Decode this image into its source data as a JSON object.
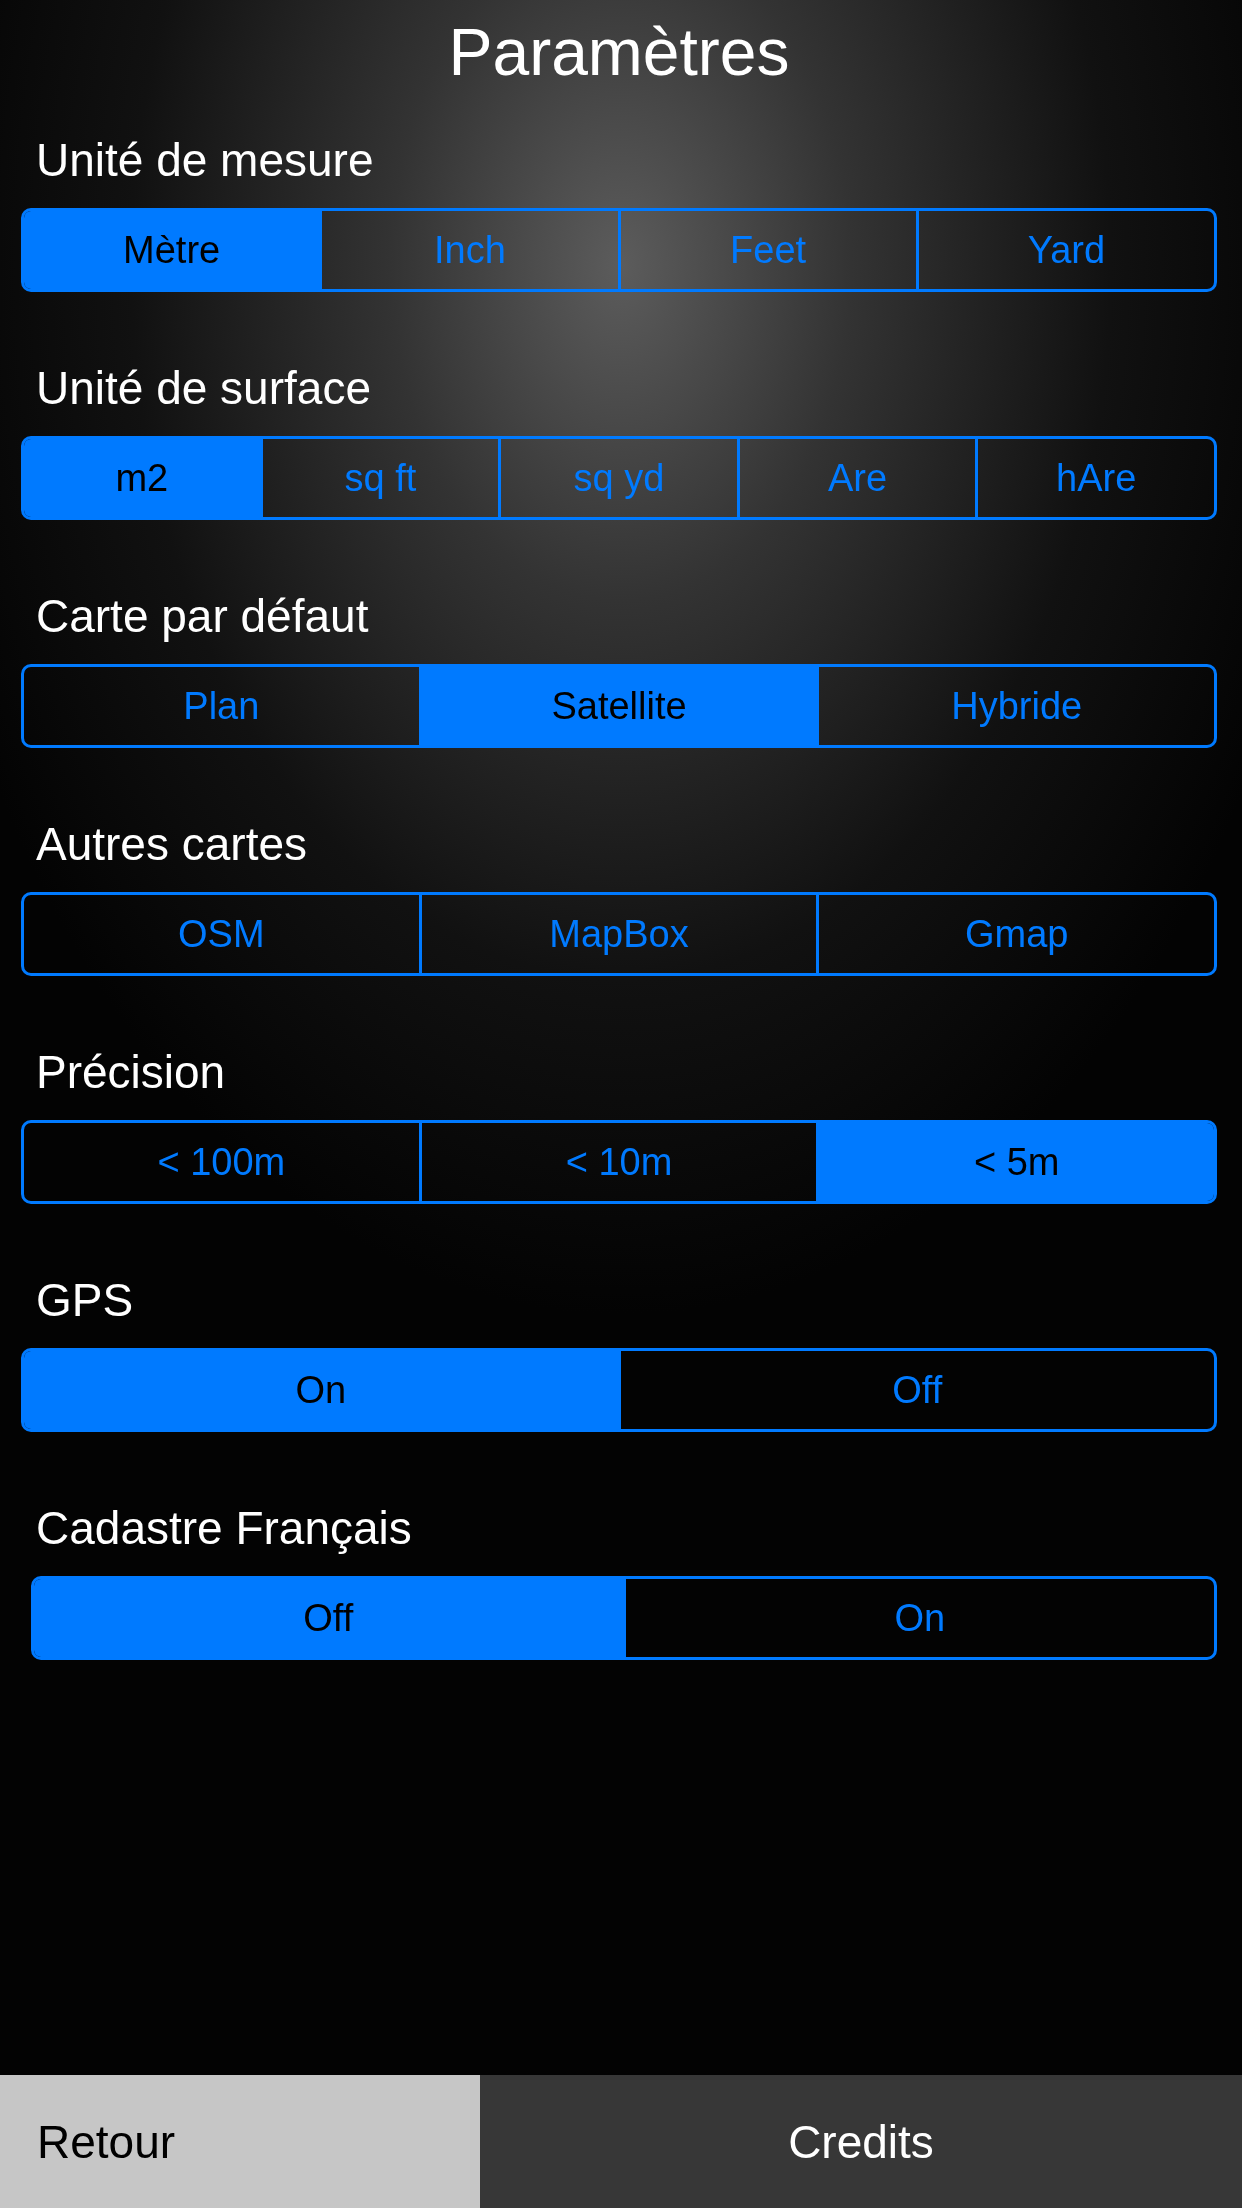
{
  "title": "Paramètres",
  "sections": [
    {
      "label": "Unité de mesure",
      "options": [
        {
          "label": "Mètre",
          "selected": true
        },
        {
          "label": "Inch",
          "selected": false
        },
        {
          "label": "Feet",
          "selected": false
        },
        {
          "label": "Yard",
          "selected": false
        }
      ]
    },
    {
      "label": "Unité de surface",
      "options": [
        {
          "label": "m2",
          "selected": true
        },
        {
          "label": "sq ft",
          "selected": false
        },
        {
          "label": "sq yd",
          "selected": false
        },
        {
          "label": "Are",
          "selected": false
        },
        {
          "label": "hAre",
          "selected": false
        }
      ]
    },
    {
      "label": "Carte par défaut",
      "options": [
        {
          "label": "Plan",
          "selected": false
        },
        {
          "label": "Satellite",
          "selected": true
        },
        {
          "label": "Hybride",
          "selected": false
        }
      ]
    },
    {
      "label": "Autres cartes",
      "options": [
        {
          "label": "OSM",
          "selected": false
        },
        {
          "label": "MapBox",
          "selected": false
        },
        {
          "label": "Gmap",
          "selected": false
        }
      ]
    },
    {
      "label": "Précision",
      "options": [
        {
          "label": "< 100m",
          "selected": false
        },
        {
          "label": "< 10m",
          "selected": false
        },
        {
          "label": "< 5m",
          "selected": true
        }
      ]
    },
    {
      "label": "GPS",
      "options": [
        {
          "label": "On",
          "selected": true
        },
        {
          "label": "Off",
          "selected": false
        }
      ]
    },
    {
      "label": "Cadastre Français",
      "options": [
        {
          "label": "Off",
          "selected": true
        },
        {
          "label": "On",
          "selected": false
        }
      ]
    }
  ],
  "bottom_bar": {
    "buttons": [
      {
        "label": "Retour",
        "kind": "back"
      },
      {
        "label": "Credits",
        "kind": "normal"
      }
    ]
  }
}
